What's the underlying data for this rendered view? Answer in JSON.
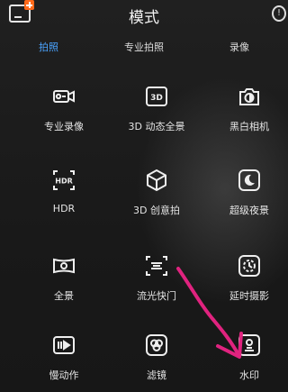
{
  "header": {
    "title": "模式"
  },
  "tabs": [
    {
      "label": "拍照",
      "active": true
    },
    {
      "label": "专业拍照",
      "active": false
    },
    {
      "label": "录像",
      "active": false
    }
  ],
  "modes": [
    {
      "label": "专业录像",
      "icon": "pro-video-icon"
    },
    {
      "label": "3D 动态全景",
      "icon": "3d-panorama-icon"
    },
    {
      "label": "黑白相机",
      "icon": "monochrome-camera-icon"
    },
    {
      "label": "HDR",
      "icon": "hdr-icon"
    },
    {
      "label": "3D 创意拍",
      "icon": "3d-cube-icon"
    },
    {
      "label": "超级夜景",
      "icon": "night-mode-icon"
    },
    {
      "label": "全景",
      "icon": "panorama-icon"
    },
    {
      "label": "流光快门",
      "icon": "light-painting-icon"
    },
    {
      "label": "延时摄影",
      "icon": "time-lapse-icon"
    },
    {
      "label": "慢动作",
      "icon": "slow-motion-icon"
    },
    {
      "label": "滤镜",
      "icon": "filter-icon"
    },
    {
      "label": "水印",
      "icon": "watermark-icon"
    }
  ],
  "colors": {
    "accent": "#4aa3ff",
    "annotation": "#e0237f",
    "badge": "#ff6a1a"
  }
}
